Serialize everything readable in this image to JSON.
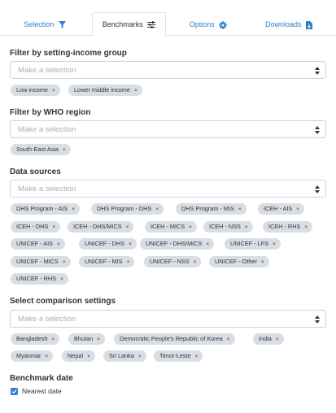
{
  "tabs": {
    "selection": "Selection",
    "benchmarks": "Benchmarks",
    "options": "Options",
    "downloads": "Downloads"
  },
  "income": {
    "label": "Filter by setting-income group",
    "placeholder": "Make a selection",
    "chips": [
      "Low income",
      "Lower middle income"
    ]
  },
  "region": {
    "label": "Filter by WHO region",
    "placeholder": "Make a selection",
    "chips": [
      "South-East Asia"
    ]
  },
  "sources": {
    "label": "Data sources",
    "placeholder": "Make a selection",
    "chips": [
      "DHS Program - AIS",
      "DHS Program - DHS",
      "DHS Program - MIS",
      "ICEH - AIS",
      "ICEH - DHS",
      "ICEH - DHS/MICS",
      "ICEH - MICS",
      "ICEH - NSS",
      "ICEH - RHS",
      "UNICEF - AIS",
      "UNICEF - DHS",
      "UNICEF - DHS/MICS",
      "UNICEF - LFS",
      "UNICEF - MICS",
      "UNICEF - MIS",
      "UNICEF - NSS",
      "UNICEF - Other",
      "UNICEF - RHS"
    ]
  },
  "comparison": {
    "label": "Select comparison settings",
    "placeholder": "Make a selection",
    "chips": [
      "Bangladesh",
      "Bhutan",
      "Democratic People's Republic of Korea",
      "India",
      "Myanmar",
      "Nepal",
      "Sri Lanka",
      "Timor-Leste"
    ]
  },
  "benchmark_date": {
    "label": "Benchmark date",
    "option": "Nearest date",
    "checked": true
  },
  "chip_remove_glyph": "×",
  "colors": {
    "accent": "#2a7fce",
    "chip_bg": "#d8dee4"
  }
}
